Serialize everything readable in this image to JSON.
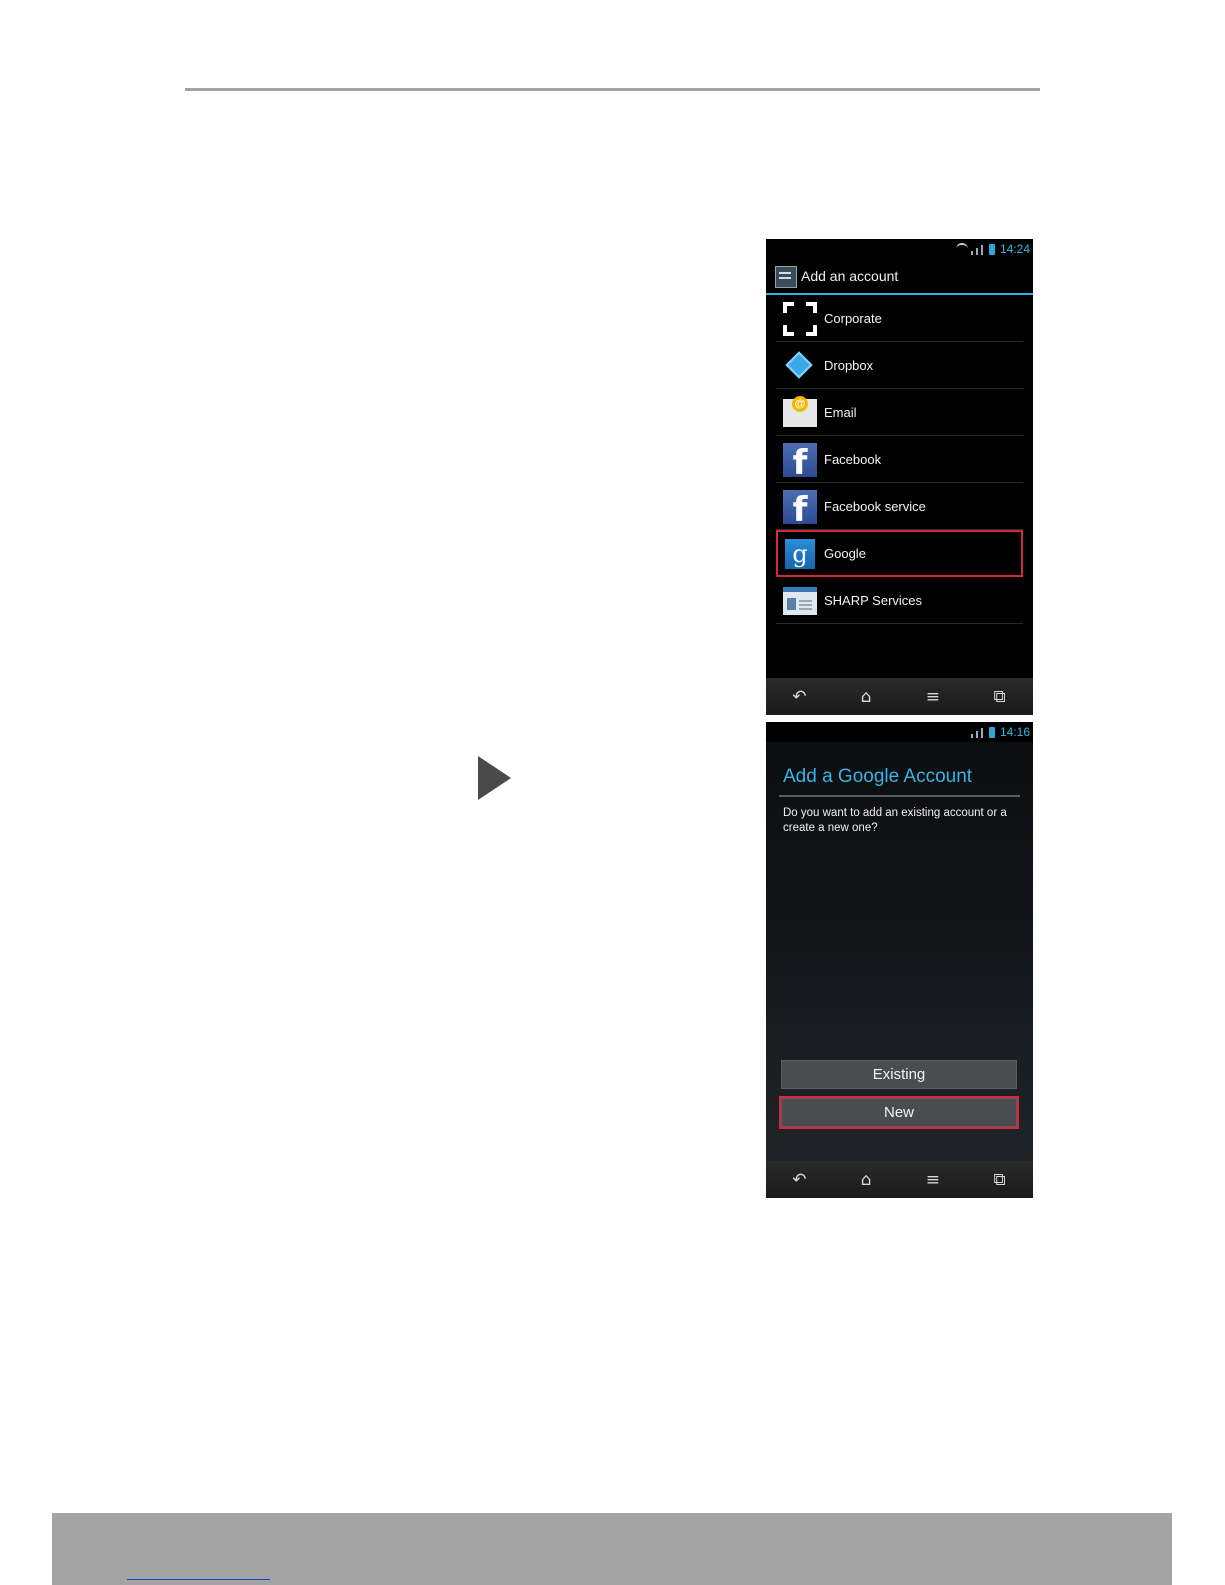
{
  "screen1": {
    "status": {
      "time": "14:24"
    },
    "title": "Add an account",
    "accounts": [
      {
        "label": "Corporate",
        "icon": "corporate-icon"
      },
      {
        "label": "Dropbox",
        "icon": "dropbox-icon"
      },
      {
        "label": "Email",
        "icon": "email-icon"
      },
      {
        "label": "Facebook",
        "icon": "facebook-icon"
      },
      {
        "label": "Facebook service",
        "icon": "facebook-icon"
      },
      {
        "label": "Google",
        "icon": "google-icon",
        "highlighted": true
      },
      {
        "label": "SHARP Services",
        "icon": "sharp-services-icon"
      }
    ],
    "nav": [
      "back-icon",
      "home-icon",
      "menu-icon",
      "recent-apps-icon"
    ]
  },
  "screen2": {
    "status": {
      "time": "14:16"
    },
    "title": "Add a Google Account",
    "prompt": "Do you want to add an existing account or a create a new one?",
    "buttons": {
      "existing": "Existing",
      "new": "New"
    },
    "nav": [
      "back-icon",
      "home-icon",
      "menu-icon",
      "recent-apps-icon"
    ]
  },
  "colors": {
    "accent": "#33b5e5",
    "highlight": "#d6283d",
    "footer": "#a3a3a3"
  }
}
